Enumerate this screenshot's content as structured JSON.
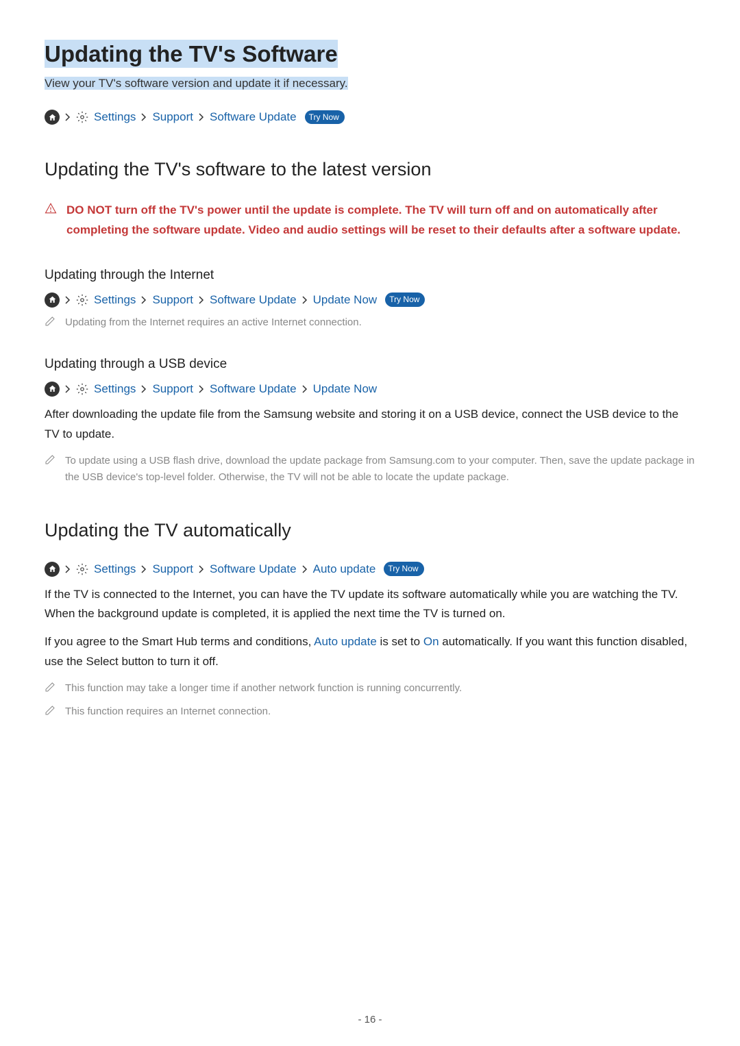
{
  "title": "Updating the TV's Software",
  "subtitle": "View your TV's software version and update it if necessary.",
  "breadcrumb_top": {
    "settings": "Settings",
    "support": "Support",
    "software_update": "Software Update",
    "try_now": "Try Now"
  },
  "section1": {
    "heading": "Updating the TV's software to the latest version",
    "warning": "DO NOT turn off the TV's power until the update is complete. The TV will turn off and on automatically after completing the software update. Video and audio settings will be reset to their defaults after a software update."
  },
  "section_internet": {
    "heading": "Updating through the Internet",
    "breadcrumb": {
      "settings": "Settings",
      "support": "Support",
      "software_update": "Software Update",
      "update_now": "Update Now",
      "try_now": "Try Now"
    },
    "note": "Updating from the Internet requires an active Internet connection."
  },
  "section_usb": {
    "heading": "Updating through a USB device",
    "breadcrumb": {
      "settings": "Settings",
      "support": "Support",
      "software_update": "Software Update",
      "update_now": "Update Now"
    },
    "body": "After downloading the update file from the Samsung website and storing it on a USB device, connect the USB device to the TV to update.",
    "note": "To update using a USB flash drive, download the update package from Samsung.com to your computer. Then, save the update package in the USB device's top-level folder. Otherwise, the TV will not be able to locate the update package."
  },
  "section_auto": {
    "heading": "Updating the TV automatically",
    "breadcrumb": {
      "settings": "Settings",
      "support": "Support",
      "software_update": "Software Update",
      "auto_update": "Auto update",
      "try_now": "Try Now"
    },
    "body1": "If the TV is connected to the Internet, you can have the TV update its software automatically while you are watching the TV. When the background update is completed, it is applied the next time the TV is turned on.",
    "body2_pre": "If you agree to the Smart Hub terms and conditions, ",
    "body2_link1": "Auto update",
    "body2_mid": " is set to ",
    "body2_link2": "On",
    "body2_post": " automatically. If you want this function disabled, use the Select button to turn it off.",
    "note1": "This function may take a longer time if another network function is running concurrently.",
    "note2": "This function requires an Internet connection."
  },
  "page_number": "- 16 -"
}
